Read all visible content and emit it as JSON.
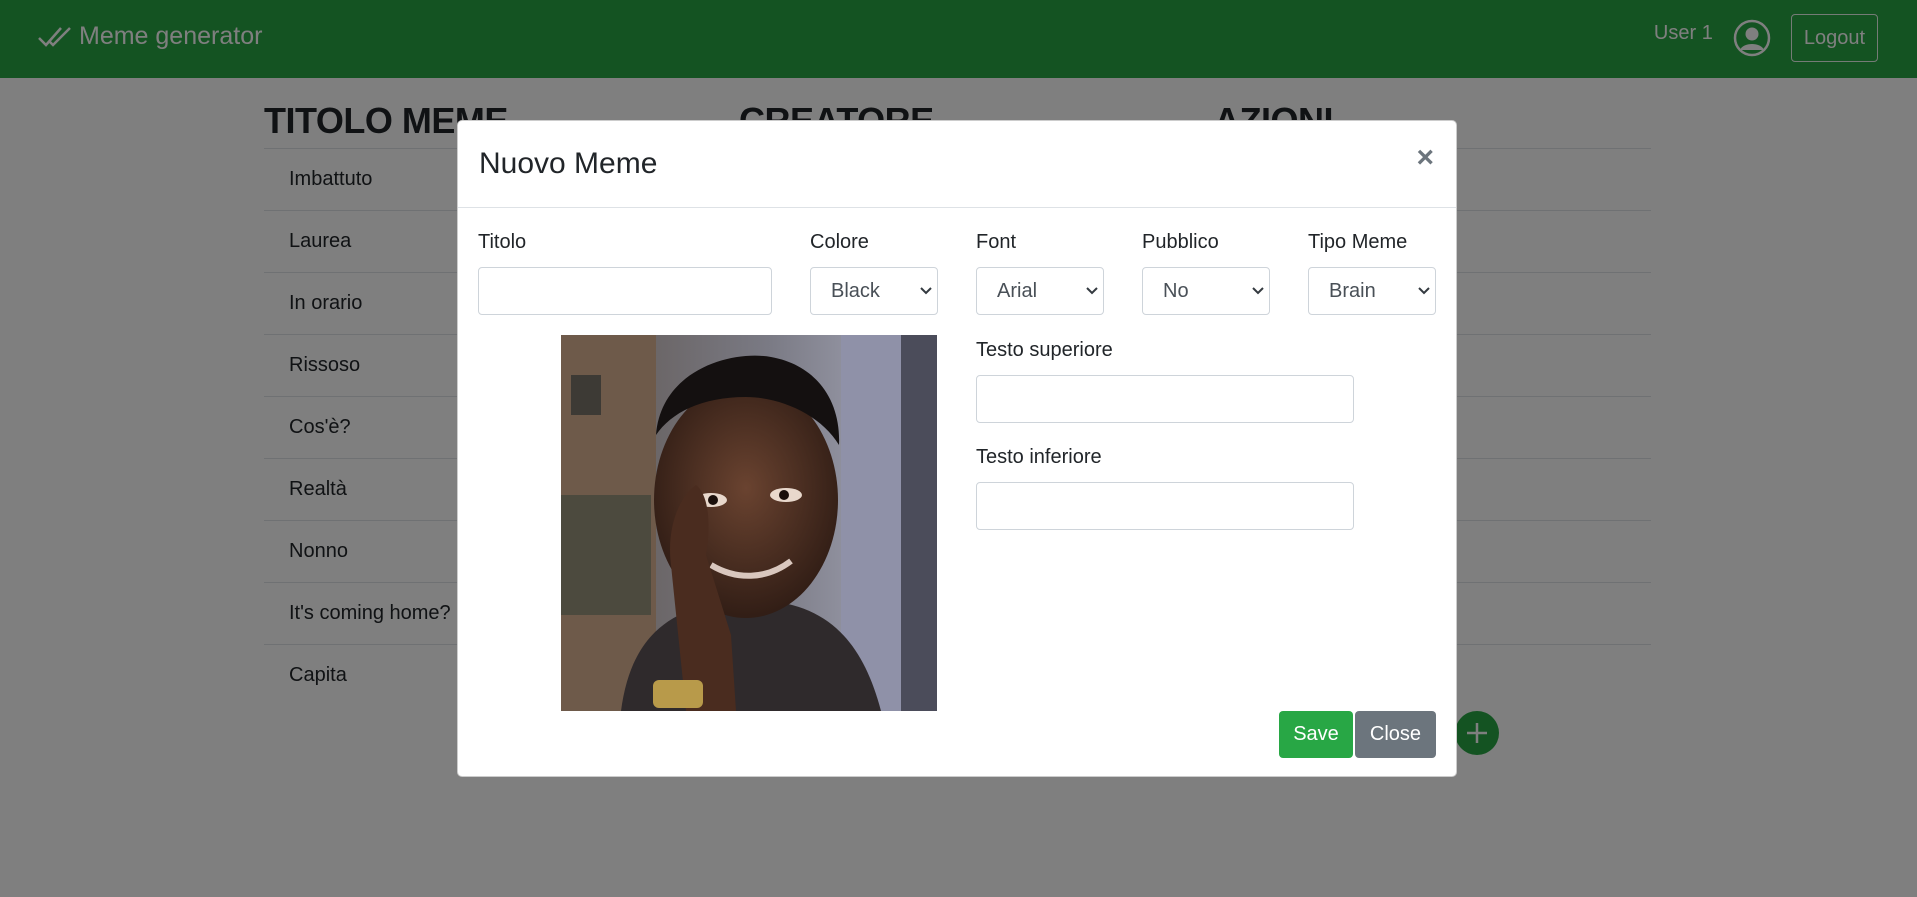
{
  "navbar": {
    "brand": "Meme generator",
    "user": "User 1",
    "logout": "Logout",
    "icons": {
      "brand": "double-check-icon",
      "user": "user-circle-icon"
    }
  },
  "table": {
    "headers": [
      "TITOLO MEME",
      "CREATORE",
      "AZIONI"
    ],
    "rows": [
      "Imbattuto",
      "Laurea",
      "In orario",
      "Rissoso",
      "Cos'è?",
      "Realtà",
      "Nonno",
      "It's coming home?",
      "Capita"
    ]
  },
  "modal": {
    "title": "Nuovo Meme",
    "close_symbol": "×",
    "fields": {
      "titolo": {
        "label": "Titolo",
        "value": ""
      },
      "colore": {
        "label": "Colore",
        "value": "Black"
      },
      "font": {
        "label": "Font",
        "value": "Arial"
      },
      "pubblico": {
        "label": "Pubblico",
        "value": "No"
      },
      "tipo": {
        "label": "Tipo Meme",
        "value": "Brain"
      },
      "testo_superiore": {
        "label": "Testo superiore",
        "value": ""
      },
      "testo_inferiore": {
        "label": "Testo inferiore",
        "value": ""
      }
    },
    "buttons": {
      "save": "Save",
      "close": "Close"
    }
  },
  "colors": {
    "navbar": "#28a745",
    "save": "#28a745",
    "close": "#6c757d",
    "backdrop": "rgba(0,0,0,0.5)"
  }
}
